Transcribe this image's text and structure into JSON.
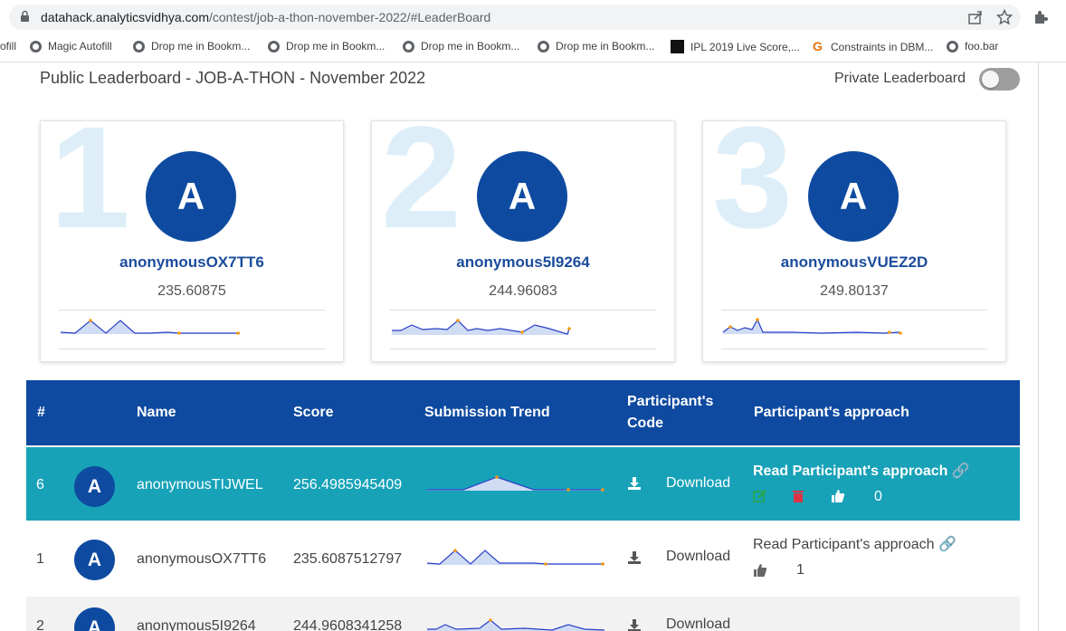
{
  "browser": {
    "url_host": "datahack.analyticsvidhya.com",
    "url_path": "/contest/job-a-thon-november-2022/#LeaderBoard",
    "icons": [
      "lock-icon",
      "share-icon",
      "star-icon",
      "extension-icon"
    ]
  },
  "bookmarks": [
    {
      "label": "ofill"
    },
    {
      "label": "Magic Autofill"
    },
    {
      "label": "Drop me in Bookm..."
    },
    {
      "label": "Drop me in Bookm..."
    },
    {
      "label": "Drop me in Bookm..."
    },
    {
      "label": "Drop me in Bookm..."
    },
    {
      "label": "IPL 2019 Live Score,..."
    },
    {
      "label": "Constraints in DBM..."
    },
    {
      "label": "foo.bar"
    }
  ],
  "header": {
    "title": "Public Leaderboard - JOB-A-THON - November 2022",
    "private_label": "Private Leaderboard",
    "private_on": false
  },
  "podium": [
    {
      "rank": "1",
      "initial": "A",
      "name": "anonymousOX7TT6",
      "score": "235.60875"
    },
    {
      "rank": "2",
      "initial": "A",
      "name": "anonymous5I9264",
      "score": "244.96083"
    },
    {
      "rank": "3",
      "initial": "A",
      "name": "anonymousVUEZ2D",
      "score": "249.80137"
    }
  ],
  "table": {
    "headers": {
      "rank": "#",
      "name": "Name",
      "score": "Score",
      "trend": "Submission Trend",
      "code_line1": "Participant's",
      "code_line2": "Code",
      "approach": "Participant's approach"
    },
    "rows": [
      {
        "rank": "6",
        "initial": "A",
        "name": "anonymousTIJWEL",
        "score": "256.4985945409",
        "download": "Download",
        "approach": "Read Participant's approach",
        "likes": "0"
      },
      {
        "rank": "1",
        "initial": "A",
        "name": "anonymousOX7TT6",
        "score": "235.6087512797",
        "download": "Download",
        "approach": "Read Participant's approach",
        "likes": "1"
      },
      {
        "rank": "2",
        "initial": "A",
        "name": "anonymous5I9264",
        "score": "244.9608341258",
        "download": "Download"
      }
    ]
  },
  "colors": {
    "primary": "#0e4aa0",
    "highlight_row": "#17a2b8",
    "edit_icon": "#28a745",
    "delete_icon": "#dc3545"
  }
}
